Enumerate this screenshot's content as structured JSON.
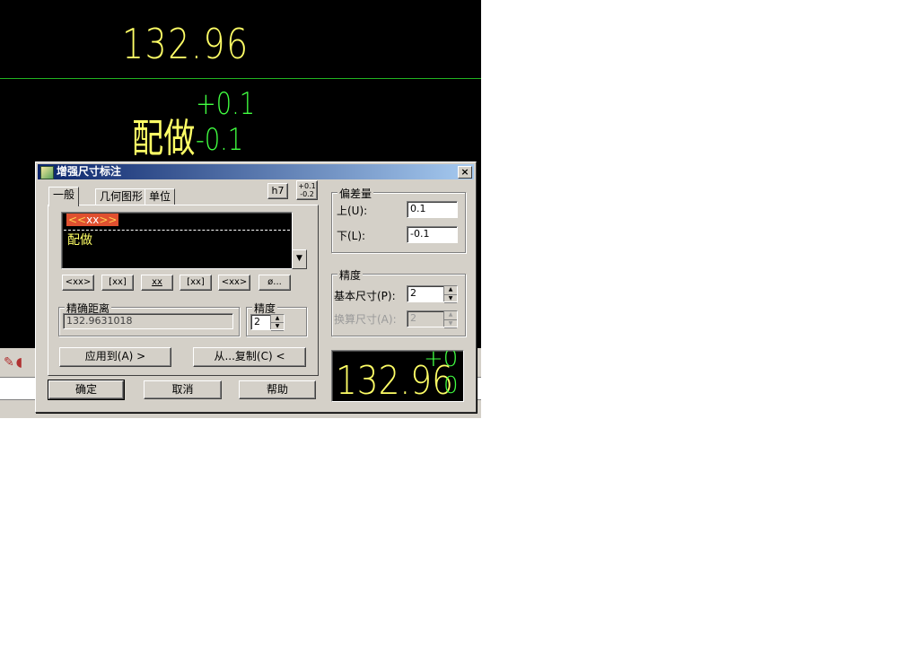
{
  "cad": {
    "dimension_value": "132.96",
    "note_text": "配做",
    "tolerance_upper": "+0.1",
    "tolerance_lower": "-0.1"
  },
  "dialog": {
    "title": "增强尺寸标注",
    "close_label": "×",
    "tabs": [
      "一般",
      "几何图形",
      "单位"
    ],
    "h7_label": "h7",
    "tol_btn_upper": "+0.1",
    "tol_btn_lower": "-0.2",
    "editor": {
      "tag_open": "<<",
      "tag_mid": "xx",
      "tag_close": ">>",
      "text": "配做",
      "dropdown_arrow": "▼"
    },
    "symbol_buttons": [
      "<xx>",
      "[xx]",
      "xx",
      "[xx]",
      "<xx>",
      "ø..."
    ],
    "exact_distance": {
      "legend": "精确距离",
      "value": "132.9631018"
    },
    "left_precision": {
      "legend": "精度",
      "value": "2"
    },
    "apply_to_label": "应用到(A) >",
    "copy_from_label": "从...复制(C) <",
    "ok_label": "确定",
    "cancel_label": "取消",
    "help_label": "帮助",
    "deviation": {
      "legend": "偏差量",
      "upper_label": "上(U):",
      "upper_value": "0.1",
      "lower_label": "下(L):",
      "lower_value": "-0.1"
    },
    "precision": {
      "legend": "精度",
      "basic_label": "基本尺寸(P):",
      "basic_value": "2",
      "alt_label": "换算尺寸(A):",
      "alt_value": "2"
    },
    "preview": {
      "number": "132.96",
      "upper": "+0",
      "lower": "0"
    },
    "colors": {
      "titlebar_start": "#0a246a",
      "titlebar_end": "#a6caf0",
      "dimension_text": "#ffff66",
      "tolerance_text": "#41ff41"
    }
  }
}
